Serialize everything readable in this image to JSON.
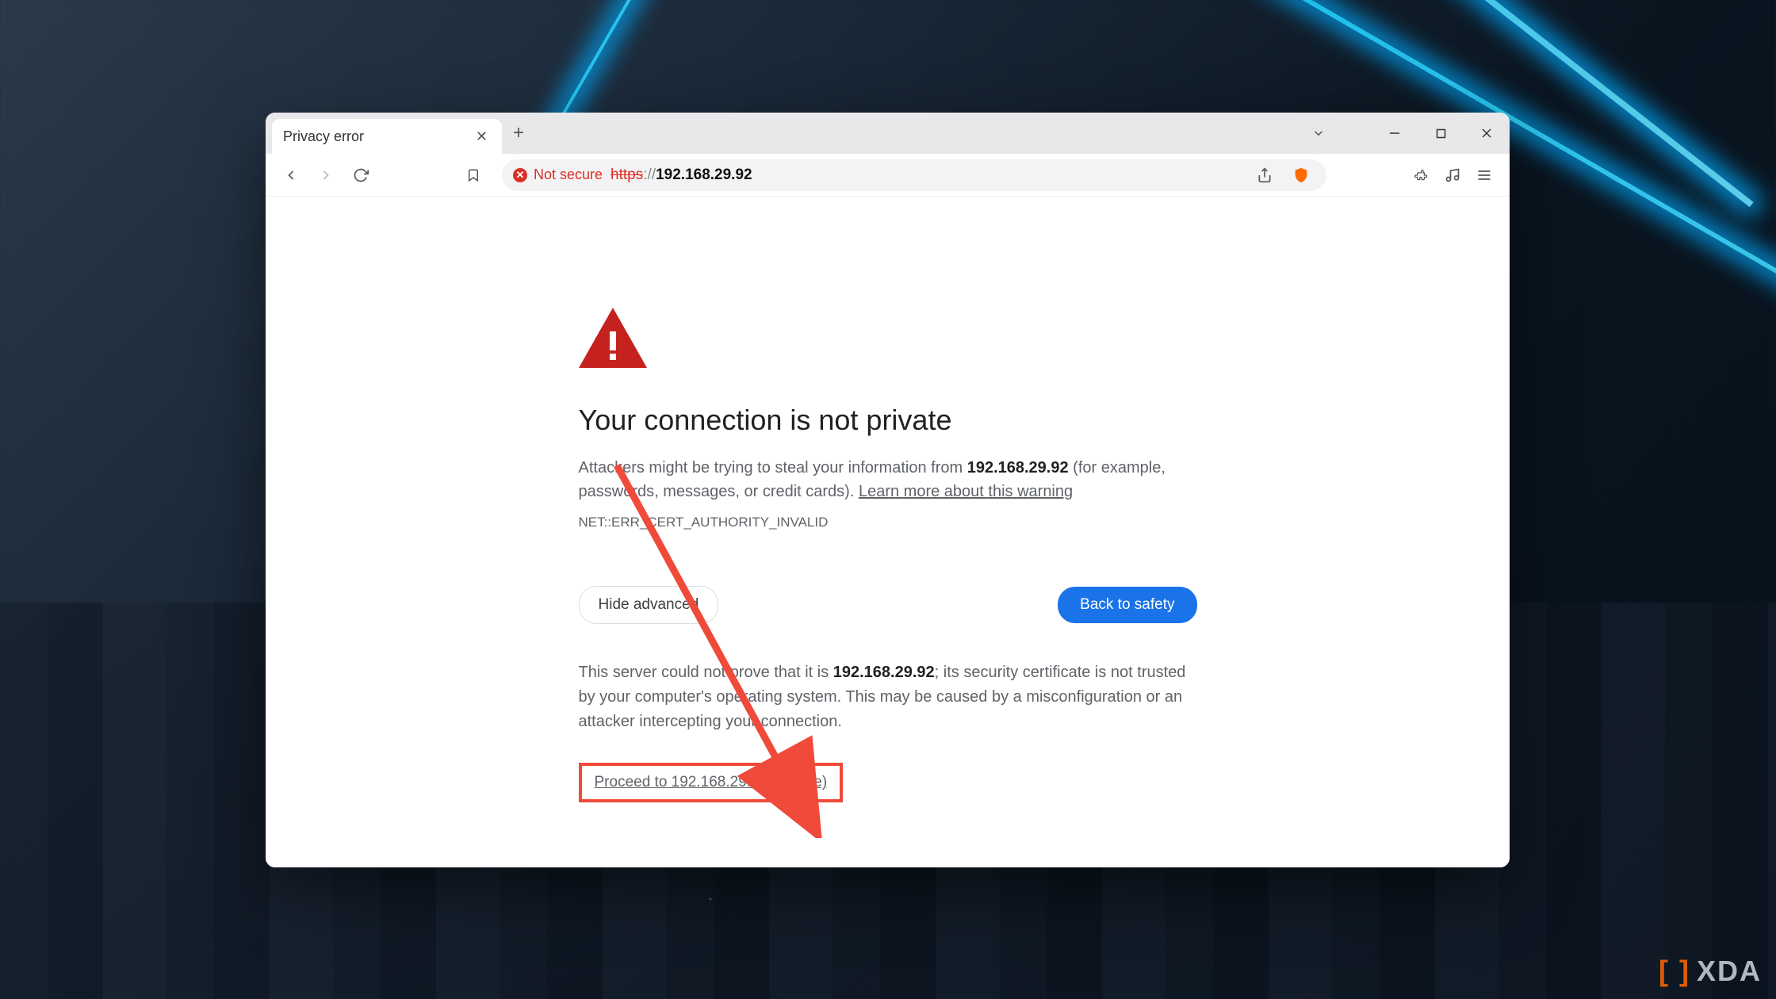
{
  "tab": {
    "title": "Privacy error"
  },
  "address": {
    "security_label": "Not secure",
    "scheme": "https",
    "sep": "://",
    "host": "192.168.29.92"
  },
  "error": {
    "heading": "Your connection is not private",
    "p1_prefix": "Attackers might be trying to steal your information from ",
    "p1_host": "192.168.29.92",
    "p1_suffix": " (for example, passwords, messages, or credit cards). ",
    "learn_more": "Learn more about this warning",
    "code": "NET::ERR_CERT_AUTHORITY_INVALID",
    "hide_advanced": "Hide advanced",
    "back_to_safety": "Back to safety",
    "adv_prefix": "This server could not prove that it is ",
    "adv_host": "192.168.29.92",
    "adv_suffix": "; its security certificate is not trusted by your computer's operating system. This may be caused by a misconfiguration or an attacker intercepting your connection.",
    "proceed": "Proceed to 192.168.29.92 (unsafe)"
  },
  "watermark": "XDA"
}
